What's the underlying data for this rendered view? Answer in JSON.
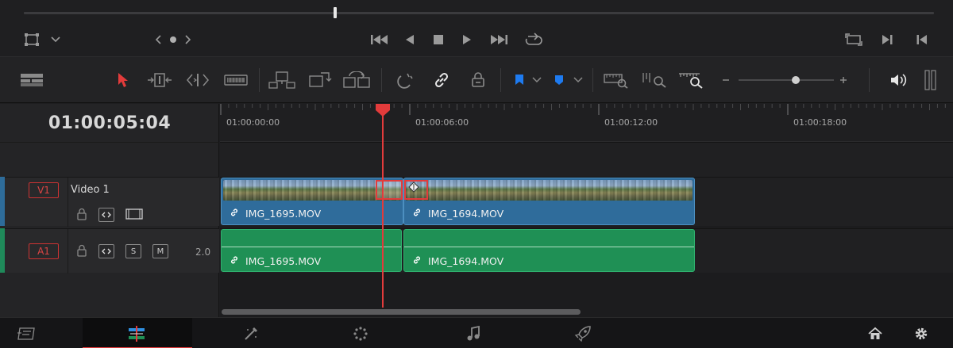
{
  "timecode": "01:00:05:04",
  "ruler": {
    "labels": [
      "01:00:00:00",
      "01:00:06:00",
      "01:00:12:00",
      "01:00:18:00"
    ]
  },
  "tracks": {
    "v1": {
      "tag": "V1",
      "name": "Video 1"
    },
    "a1": {
      "tag": "A1",
      "solo": "S",
      "mute": "M",
      "channels": "2.0"
    }
  },
  "clips": {
    "video": [
      "IMG_1695.MOV",
      "IMG_1694.MOV"
    ],
    "audio": [
      "IMG_1695.MOV",
      "IMG_1694.MOV"
    ]
  },
  "colors": {
    "accent": "#e23b3b",
    "video_clip": "#2f6c9b",
    "audio_clip": "#1f9055",
    "flag_blue": "#1e7bf0"
  },
  "icons": {
    "transport": [
      "crop-icon",
      "chevron-down-icon",
      "prev-next-edit-icon",
      "jump-start-icon",
      "play-reverse-icon",
      "stop-icon",
      "play-icon",
      "jump-end-icon",
      "loop-icon",
      "fullscreen-icon",
      "next-clip-icon",
      "prev-clip-icon"
    ],
    "toolbar": [
      "timeline-options-icon",
      "selection-pointer-icon",
      "trim-edit-icon",
      "dynamic-trim-icon",
      "blade-icon",
      "insert-clip-icon",
      "overwrite-clip-icon",
      "replace-clip-icon",
      "snapping-icon",
      "linked-selection-icon",
      "position-lock-icon",
      "flag-icon",
      "marker-icon",
      "zoom-full-icon",
      "zoom-detail-icon",
      "zoom-custom-icon",
      "zoom-out-icon",
      "zoom-in-icon",
      "audio-volume-icon"
    ],
    "pages": [
      "cut-page-icon",
      "edit-page-icon",
      "fusion-page-icon",
      "color-page-icon",
      "fairlight-page-icon",
      "deliver-page-icon",
      "home-icon",
      "settings-icon"
    ]
  },
  "zoom_level": 0.7
}
